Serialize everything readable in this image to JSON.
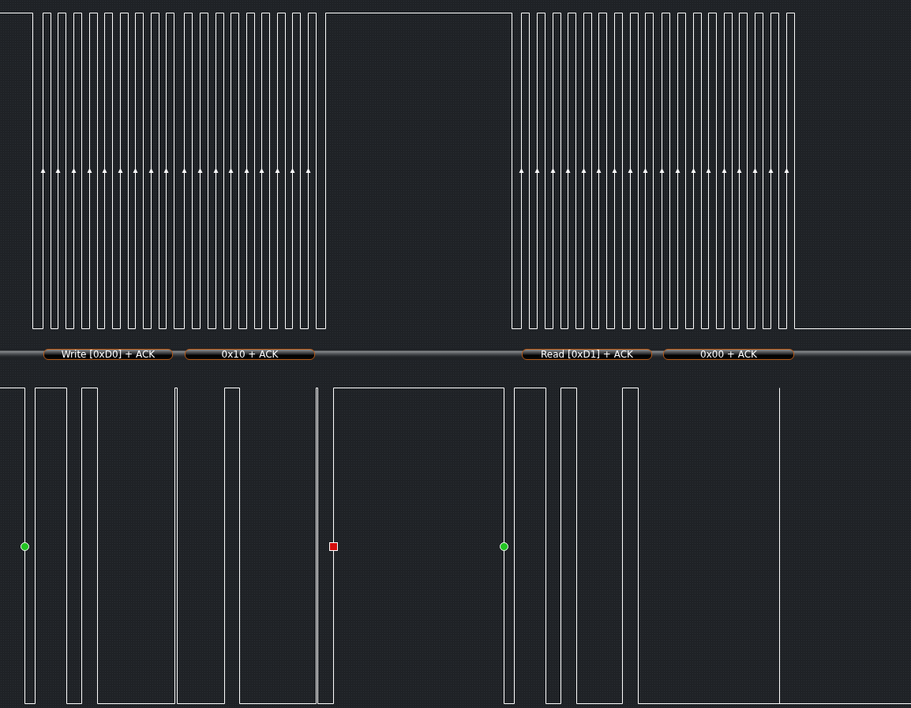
{
  "decoded_frames": [
    {
      "text": "Write [0xD0] + ACK"
    },
    {
      "text": "0x10 + ACK"
    },
    {
      "text": "Read [0xD1] + ACK"
    },
    {
      "text": "0x00 + ACK"
    }
  ],
  "markers": [
    {
      "kind": "start"
    },
    {
      "kind": "stop"
    },
    {
      "kind": "start"
    }
  ]
}
